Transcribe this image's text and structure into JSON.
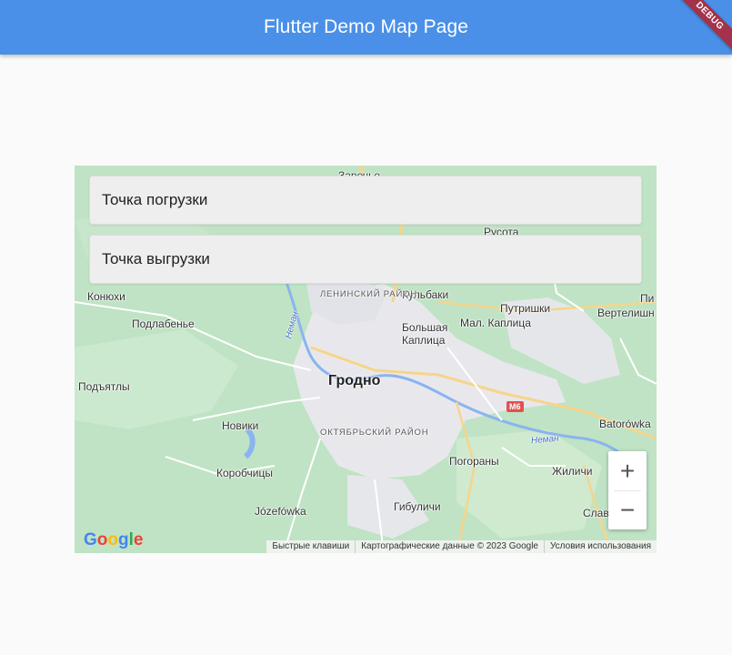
{
  "appbar": {
    "title": "Flutter Demo Map Page",
    "debug": "DEBUG"
  },
  "form": {
    "pickup_placeholder": "Точка погрузки",
    "dropoff_placeholder": "Точка выгрузки"
  },
  "map": {
    "city": "Гродно",
    "districts": [
      "ЛЕНИНСКИЙ РАЙОН",
      "ОКТЯБРЬСКИЙ РАЙОН"
    ],
    "places": {
      "zarechye": "Заречье",
      "rusota": "Русота",
      "konyukhi": "Конюхи",
      "kulbaki": "Кульбаки",
      "putrishki": "Путришки",
      "pi": "Пи",
      "vertelishki": "Вертелишн",
      "podlabenye": "Подлабенье",
      "bolshaya_kaplitsa": "Большая Каплица",
      "mal_kaplitsa": "Мал. Каплица",
      "podyatly": "Подъятлы",
      "novik": "Новики",
      "batorowka": "Batorówka",
      "pogorany": "Погораны",
      "korobchitsy": "Коробчицы",
      "zhilichi": "Жиличи",
      "jozefowka": "Józefówka",
      "gibulichi": "Гибуличи",
      "slav": "Слав"
    },
    "rivers": [
      "Неман",
      "Неман"
    ],
    "road_badge": "M6",
    "zoom_in": "+",
    "zoom_out": "−",
    "google": "Google",
    "attribution": {
      "shortcuts": "Быстрые клавиши",
      "map_data": "Картографические данные © 2023 Google",
      "terms": "Условия использования"
    }
  }
}
